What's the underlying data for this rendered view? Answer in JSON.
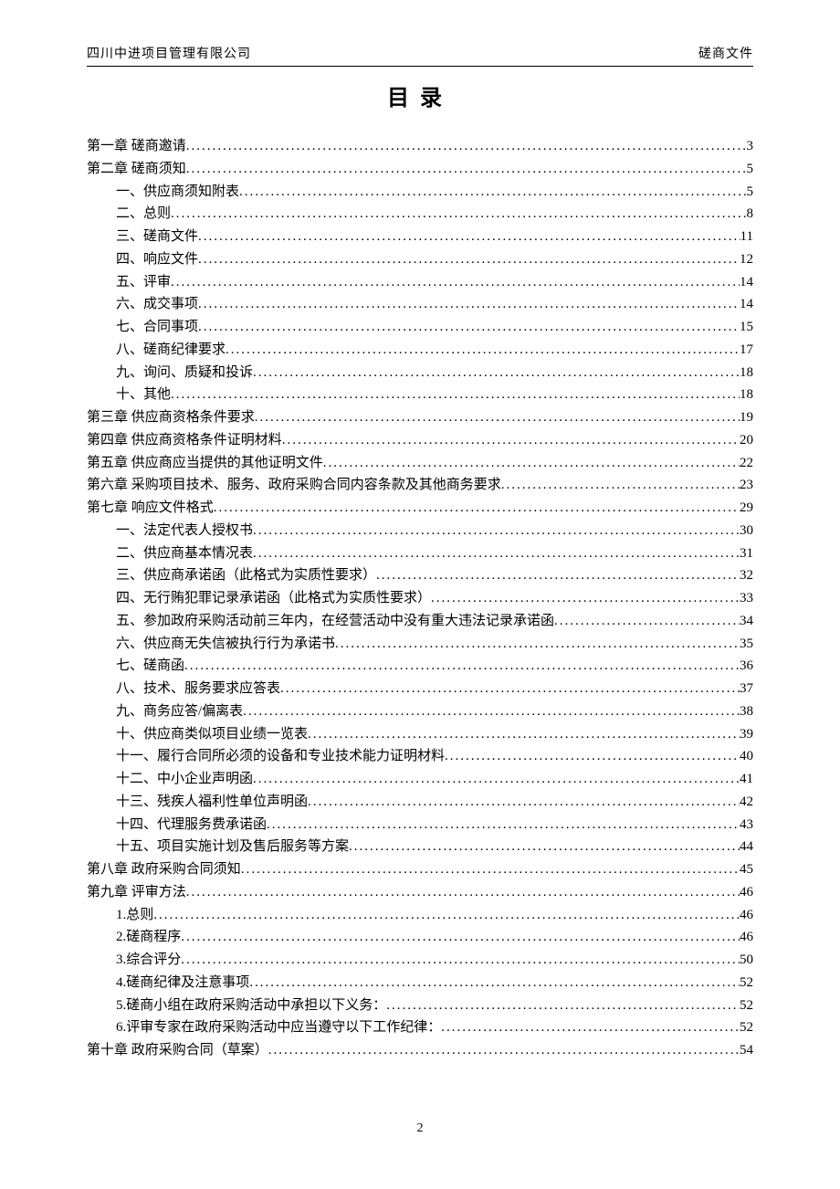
{
  "header": {
    "left": "四川中进项目管理有限公司",
    "right": "磋商文件"
  },
  "title": "目录",
  "toc": [
    {
      "level": 0,
      "label": "第一章 磋商邀请",
      "page": "3"
    },
    {
      "level": 0,
      "label": "第二章 磋商须知",
      "page": "5"
    },
    {
      "level": 1,
      "label": "一、供应商须知附表",
      "page": "5"
    },
    {
      "level": 1,
      "label": "二、总则",
      "page": "8"
    },
    {
      "level": 1,
      "label": "三、磋商文件",
      "page": "11"
    },
    {
      "level": 1,
      "label": "四、响应文件",
      "page": "12"
    },
    {
      "level": 1,
      "label": "五、评审",
      "page": "14"
    },
    {
      "level": 1,
      "label": "六、成交事项",
      "page": "14"
    },
    {
      "level": 1,
      "label": "七、合同事项",
      "page": "15"
    },
    {
      "level": 1,
      "label": "八、磋商纪律要求",
      "page": "17"
    },
    {
      "level": 1,
      "label": "九、询问、质疑和投诉",
      "page": "18"
    },
    {
      "level": 1,
      "label": "十、其他",
      "page": "18"
    },
    {
      "level": 0,
      "label": "第三章 供应商资格条件要求",
      "page": "19"
    },
    {
      "level": 0,
      "label": "第四章 供应商资格条件证明材料",
      "page": "20"
    },
    {
      "level": 0,
      "label": "第五章 供应商应当提供的其他证明文件",
      "page": "22"
    },
    {
      "level": 0,
      "label": "第六章 采购项目技术、服务、政府采购合同内容条款及其他商务要求",
      "page": "23"
    },
    {
      "level": 0,
      "label": "第七章 响应文件格式",
      "page": "29"
    },
    {
      "level": 1,
      "label": "一、法定代表人授权书",
      "page": "30"
    },
    {
      "level": 1,
      "label": "二、供应商基本情况表",
      "page": "31"
    },
    {
      "level": 1,
      "label": "三、供应商承诺函（此格式为实质性要求）",
      "page": "32"
    },
    {
      "level": 1,
      "label": "四、无行贿犯罪记录承诺函（此格式为实质性要求）",
      "page": "33"
    },
    {
      "level": 1,
      "label": "五、参加政府采购活动前三年内，在经营活动中没有重大违法记录承诺函",
      "page": "34"
    },
    {
      "level": 1,
      "label": "六、供应商无失信被执行行为承诺书",
      "page": "35"
    },
    {
      "level": 1,
      "label": "七、磋商函",
      "page": "36"
    },
    {
      "level": 1,
      "label": "八、技术、服务要求应答表",
      "page": "37"
    },
    {
      "level": 1,
      "label": "九、商务应答/偏离表",
      "page": "38"
    },
    {
      "level": 1,
      "label": "十、供应商类似项目业绩一览表",
      "page": "39"
    },
    {
      "level": 1,
      "label": "十一、履行合同所必须的设备和专业技术能力证明材料",
      "page": "40"
    },
    {
      "level": 1,
      "label": "十二、中小企业声明函",
      "page": "41"
    },
    {
      "level": 1,
      "label": "十三、残疾人福利性单位声明函",
      "page": "42"
    },
    {
      "level": 1,
      "label": "十四、代理服务费承诺函 ",
      "page": "43"
    },
    {
      "level": 1,
      "label": "十五、项目实施计划及售后服务等方案",
      "page": "44"
    },
    {
      "level": 0,
      "label": "第八章 政府采购合同须知",
      "page": "45"
    },
    {
      "level": 0,
      "label": "第九章 评审方法",
      "page": "46"
    },
    {
      "level": 1,
      "label": "1.总则",
      "page": "46"
    },
    {
      "level": 1,
      "label": "2.磋商程序",
      "page": "46"
    },
    {
      "level": 1,
      "label": "3.综合评分",
      "page": "50"
    },
    {
      "level": 1,
      "label": "4.磋商纪律及注意事项",
      "page": "52"
    },
    {
      "level": 1,
      "label": "5.磋商小组在政府采购活动中承担以下义务：",
      "page": "52"
    },
    {
      "level": 1,
      "label": "6.评审专家在政府采购活动中应当遵守以下工作纪律：",
      "page": "52"
    },
    {
      "level": 0,
      "label": "第十章 政府采购合同（草案）",
      "page": "54"
    }
  ],
  "page_number": "2"
}
